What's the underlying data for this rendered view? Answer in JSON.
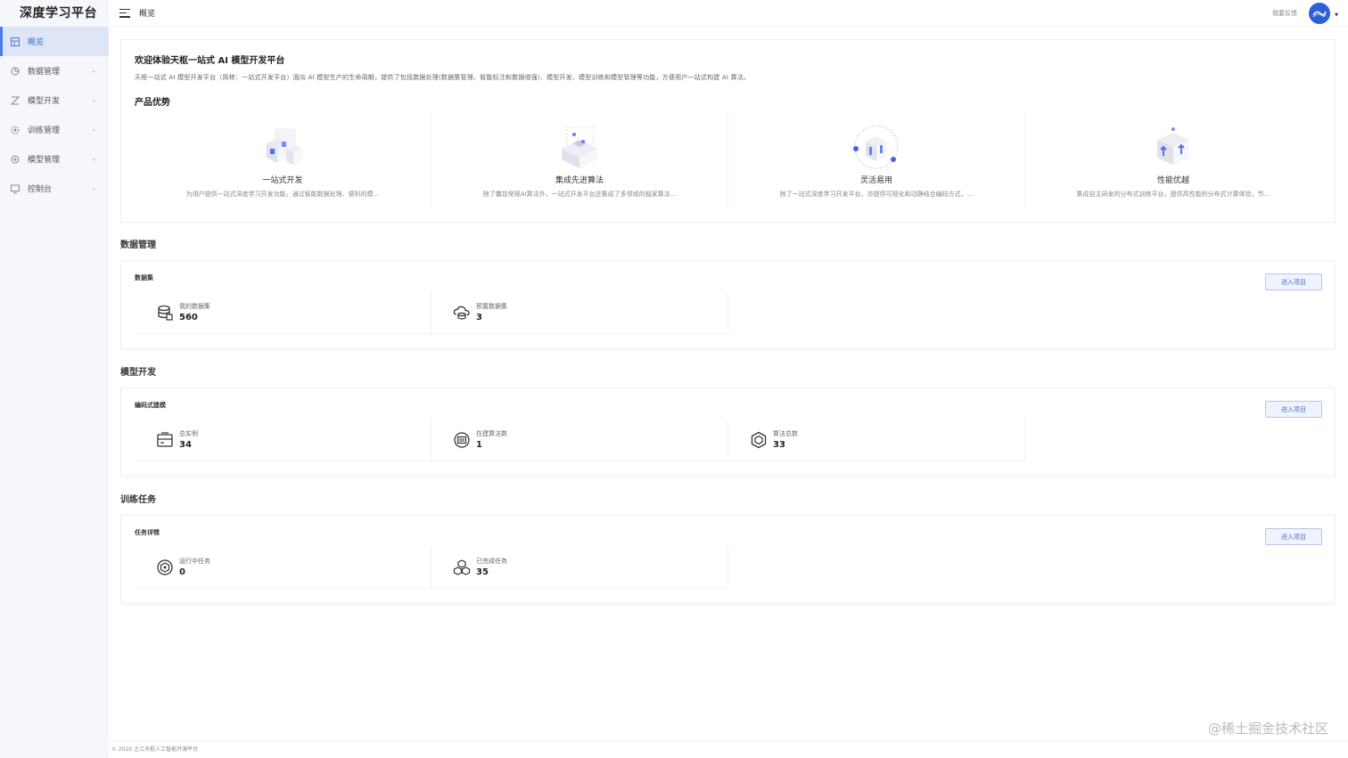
{
  "app": {
    "title": "深度学习平台"
  },
  "sidebar": {
    "items": [
      {
        "label": "概览",
        "icon": "overview-icon",
        "active": true
      },
      {
        "label": "数据管理",
        "icon": "data-icon"
      },
      {
        "label": "模型开发",
        "icon": "model-dev-icon"
      },
      {
        "label": "训练管理",
        "icon": "train-icon"
      },
      {
        "label": "模型管理",
        "icon": "model-manage-icon"
      },
      {
        "label": "控制台",
        "icon": "console-icon"
      }
    ]
  },
  "header": {
    "title": "概览",
    "feedback": "我要反馈"
  },
  "welcome": {
    "title": "欢迎体验天枢一站式 AI 模型开发平台",
    "desc": "天枢一站式 AI 模型开发平台（简称：一站式开发平台）面向 AI 模型生产的生命周期，提供了包括数据处理(数据集管理、智能标注和数据增强)、模型开发、模型训练和模型管理等功能，方便用户一站式构建 AI 算法。",
    "adv_title": "产品优势",
    "advantages": [
      {
        "name": "一站式开发",
        "desc": "为用户提供一站式深度学习开发功能，通过智能数据处理、便利的模..."
      },
      {
        "name": "集成先进算法",
        "desc": "除了囊括常规AI算法外，一站式开发平台还集成了多领域的独家算法..."
      },
      {
        "name": "灵活易用",
        "desc": "除了一站式深度学习开发平台，亦提供可视化和动静结合编码方式，..."
      },
      {
        "name": "性能优越",
        "desc": "集成自主研发的分布式训练平台，提供高性能的分布式计算体验，节..."
      }
    ]
  },
  "sections": {
    "data": {
      "title": "数据管理",
      "block_title": "数据集",
      "enter": "进入项目",
      "stats": [
        {
          "label": "我的数据集",
          "value": "560"
        },
        {
          "label": "预置数据集",
          "value": "3"
        }
      ]
    },
    "model": {
      "title": "模型开发",
      "block_title": "编码式建模",
      "enter": "进入项目",
      "stats": [
        {
          "label": "总实例",
          "value": "34"
        },
        {
          "label": "在建算法数",
          "value": "1"
        },
        {
          "label": "算法总数",
          "value": "33"
        }
      ]
    },
    "train": {
      "title": "训练任务",
      "block_title": "任务详情",
      "enter": "进入项目",
      "stats": [
        {
          "label": "运行中任务",
          "value": "0"
        },
        {
          "label": "已完成任务",
          "value": "35"
        }
      ]
    }
  },
  "footer": {
    "text": "© 2020 之江天枢人工智能开源平台"
  },
  "watermark": "@稀土掘金技术社区",
  "colors": {
    "accent": "#4a7be6",
    "avatar": "#2d5fd6"
  }
}
